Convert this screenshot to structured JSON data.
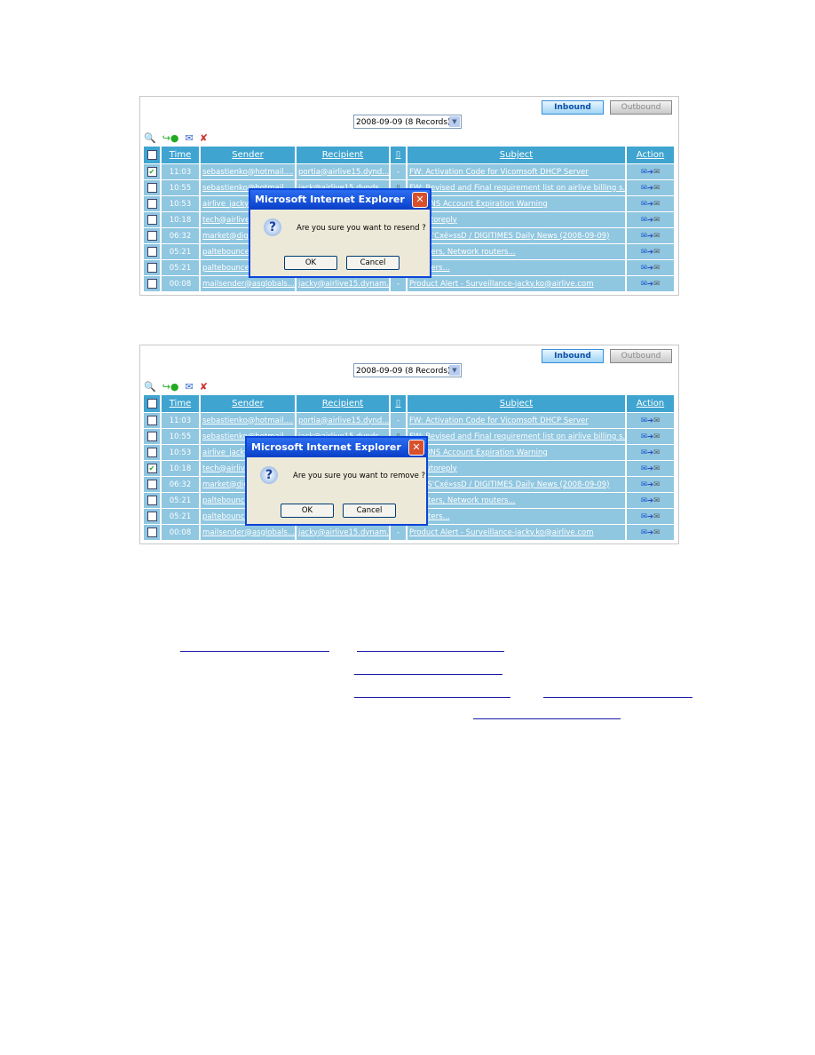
{
  "panels": [
    {
      "inbound": "Inbound",
      "outbound": "Outbound",
      "date_select": "2008-09-09 (8 Records)",
      "headers": {
        "time": "Time",
        "sender": "Sender",
        "recipient": "Recipient",
        "subject": "Subject",
        "action": "Action"
      },
      "checked_row": 0,
      "rows": [
        {
          "time": "11:03",
          "sender": "sebastienko@hotmail....",
          "recipient": "portia@airlive15.dynd...",
          "attach": "-",
          "subject": "FW: Activation Code for Vicomsoft DHCP Server"
        },
        {
          "time": "10:55",
          "sender": "sebastienko@hotmail....",
          "recipient": "jack@airlive15.dynds...",
          "attach": "clip",
          "subject": "FW: Revised and Final requirement list on airlive billing s..."
        },
        {
          "time": "10:53",
          "sender": "airlive_jacky",
          "recipient": "",
          "attach": "",
          "subject": "DynDNS Account Expiration Warning"
        },
        {
          "time": "10:18",
          "sender": "tech@airlive",
          "recipient": "",
          "attach": "",
          "subject": "an autoreply"
        },
        {
          "time": "06:32",
          "sender": "market@digi",
          "recipient": "",
          "attach": "",
          "subject": "TIMES'Cxé»ssD / DIGITIMES Daily News (2008-09-09)"
        },
        {
          "time": "05:21",
          "sender": "paltebounce",
          "recipient": "",
          "attach": "",
          "subject": "s routers, Network routers..."
        },
        {
          "time": "05:21",
          "sender": "paltebounce",
          "recipient": "",
          "attach": "",
          "subject": "s routers..."
        },
        {
          "time": "00:08",
          "sender": "mailsender@asglobals...",
          "recipient": "jacky@airlive15.dynam...",
          "attach": "-",
          "subject": "Product Alert - Surveillance-jacky.ko@airlive.com"
        }
      ],
      "dialog": {
        "title": "Microsoft Internet Explorer",
        "message": "Are you sure you want to resend ?",
        "ok": "OK",
        "cancel": "Cancel"
      }
    },
    {
      "inbound": "Inbound",
      "outbound": "Outbound",
      "date_select": "2008-09-09 (8 Records)",
      "headers": {
        "time": "Time",
        "sender": "Sender",
        "recipient": "Recipient",
        "subject": "Subject",
        "action": "Action"
      },
      "checked_row": 3,
      "rows": [
        {
          "time": "11:03",
          "sender": "sebastienko@hotmail....",
          "recipient": "portia@airlive15.dynd...",
          "attach": "-",
          "subject": "FW: Activation Code for Vicomsoft DHCP Server"
        },
        {
          "time": "10:55",
          "sender": "sebastienko@hotmail....",
          "recipient": "jack@airlive15.dynds...",
          "attach": "clip",
          "subject": "FW: Revised and Final requirement list on airlive billing s..."
        },
        {
          "time": "10:53",
          "sender": "airlive_jacky",
          "recipient": "",
          "attach": "",
          "subject": "DynDNS Account Expiration Warning"
        },
        {
          "time": "10:18",
          "sender": "tech@airlive",
          "recipient": "",
          "attach": "",
          "subject": "an autoreply"
        },
        {
          "time": "06:32",
          "sender": "market@digi",
          "recipient": "",
          "attach": "",
          "subject": "TIMES'Cxé»ssD / DIGITIMES Daily News (2008-09-09)"
        },
        {
          "time": "05:21",
          "sender": "paltebounce",
          "recipient": "",
          "attach": "",
          "subject": "s routers, Network routers..."
        },
        {
          "time": "05:21",
          "sender": "paltebounce",
          "recipient": "",
          "attach": "",
          "subject": "s routers..."
        },
        {
          "time": "00:08",
          "sender": "mailsender@asglobals...",
          "recipient": "jacky@airlive15.dynam...",
          "attach": "-",
          "subject": "Product Alert - Surveillance-jacky.ko@airlive.com"
        }
      ],
      "dialog": {
        "title": "Microsoft Internet Explorer",
        "message": "Are you sure you want to remove ?",
        "ok": "OK",
        "cancel": "Cancel"
      }
    }
  ],
  "colors": {
    "header": "#3fa4d0",
    "row": "#8fc6e0",
    "dialog_title": "#0b44d8",
    "link": "#1a1aa8"
  }
}
